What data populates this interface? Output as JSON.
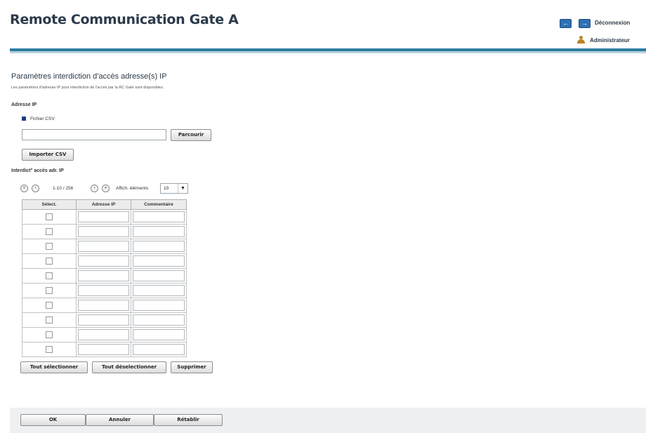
{
  "header": {
    "app_title": "Remote Communication Gate A",
    "logout_label": "Déconnexion",
    "user_label": "Administrateur"
  },
  "page": {
    "title": "Paramètres interdiction d'accès adresse(s) IP",
    "description": "Les paramètres d'adresse IP pour interdiction de l'accès par la RC Gate sont disponibles.",
    "section_ip_label": "Adresse IP",
    "csv_label": "Fichier CSV",
    "csv_path_value": "",
    "browse_label": "Parcourir",
    "import_label": "Importer CSV",
    "list_label": "Interdict° accès adr. IP"
  },
  "pagination": {
    "range": "1-10 / 256",
    "items_label": "Affich. éléments",
    "items_selected": "10"
  },
  "table": {
    "headers": [
      "Sélect.",
      "Adresse IP",
      "Commentaire"
    ],
    "rows": [
      {
        "ip": "",
        "comment": ""
      },
      {
        "ip": "",
        "comment": ""
      },
      {
        "ip": "",
        "comment": ""
      },
      {
        "ip": "",
        "comment": ""
      },
      {
        "ip": "",
        "comment": ""
      },
      {
        "ip": "",
        "comment": ""
      },
      {
        "ip": "",
        "comment": ""
      },
      {
        "ip": "",
        "comment": ""
      },
      {
        "ip": "",
        "comment": ""
      },
      {
        "ip": "",
        "comment": ""
      }
    ]
  },
  "actions": {
    "select_all": "Tout sélectionner",
    "deselect_all": "Tout déselectionner",
    "delete": "Supprimer"
  },
  "footer": {
    "ok": "OK",
    "cancel": "Annuler",
    "reset": "Rétablir"
  },
  "colors": {
    "header_bar": "#2e7ba0",
    "accent_button": "#2f6fb3",
    "footer_bg": "#eef0f1"
  }
}
